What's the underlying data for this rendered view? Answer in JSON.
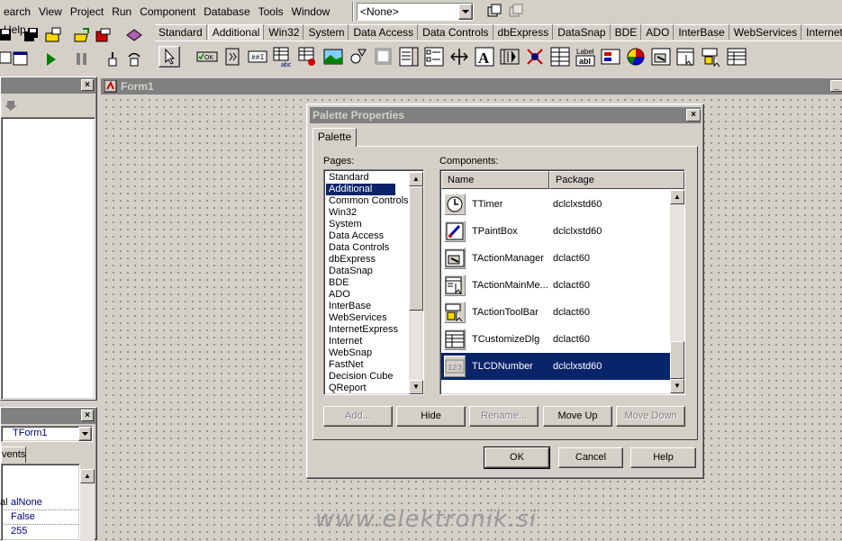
{
  "menubar": {
    "items": [
      "earch",
      "View",
      "Project",
      "Run",
      "Component",
      "Database",
      "Tools",
      "Window",
      "Help"
    ],
    "combo_value": "<None>"
  },
  "palette": {
    "tabs": [
      "Standard",
      "Additional",
      "Win32",
      "System",
      "Data Access",
      "Data Controls",
      "dbExpress",
      "DataSnap",
      "BDE",
      "ADO",
      "InterBase",
      "WebServices",
      "InternetExpress"
    ],
    "active_tab": "Additional",
    "icon_label": "Label",
    "icon_btn_text": "OK"
  },
  "form": {
    "title": "Form1"
  },
  "object_inspector": {
    "combo_value": "TForm1",
    "tab": "vents",
    "rows": [
      "alNone",
      "False",
      "255"
    ],
    "row_prefix": "al"
  },
  "dialog": {
    "title": "Palette Properties",
    "tab": "Palette",
    "pages_label": "Pages:",
    "components_label": "Components:",
    "col_name": "Name",
    "col_package": "Package",
    "pages": [
      "Standard",
      "Additional",
      "Common Controls",
      "Win32",
      "System",
      "Data Access",
      "Data Controls",
      "dbExpress",
      "DataSnap",
      "BDE",
      "ADO",
      "InterBase",
      "WebServices",
      "InternetExpress",
      "Internet",
      "WebSnap",
      "FastNet",
      "Decision Cube",
      "QReport"
    ],
    "selected_page": "Additional",
    "components": [
      {
        "name": "TTimer",
        "package": "dclclxstd60",
        "icon": "clock-icon"
      },
      {
        "name": "TPaintBox",
        "package": "dclclxstd60",
        "icon": "paintbox-icon"
      },
      {
        "name": "TActionManager",
        "package": "dclact60",
        "icon": "action-manager-icon"
      },
      {
        "name": "TActionMainMe...",
        "package": "dclact60",
        "icon": "action-mainmenu-icon"
      },
      {
        "name": "TActionToolBar",
        "package": "dclact60",
        "icon": "action-toolbar-icon"
      },
      {
        "name": "TCustomizeDlg",
        "package": "dclact60",
        "icon": "customize-dialog-icon"
      },
      {
        "name": "TLCDNumber",
        "package": "dclclxstd60",
        "icon": "lcd-number-icon"
      }
    ],
    "selected_component": "TLCDNumber",
    "lcd_glyph": "123",
    "buttons": {
      "add": "Add...",
      "hide": "Hide",
      "rename": "Rename...",
      "move_up": "Move Up",
      "move_down": "Move Down",
      "ok": "OK",
      "cancel": "Cancel",
      "help": "Help"
    }
  },
  "watermark": "www.elektronik.si"
}
